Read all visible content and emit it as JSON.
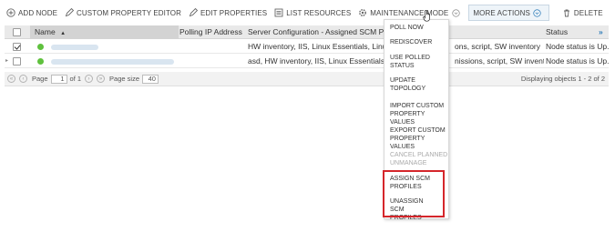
{
  "toolbar": {
    "add_node": "ADD NODE",
    "custom_property_editor": "CUSTOM PROPERTY EDITOR",
    "edit_properties": "EDIT PROPERTIES",
    "list_resources": "LIST RESOURCES",
    "maintenance_mode": "MAINTENANCE MODE",
    "more_actions": "MORE ACTIONS",
    "delete": "DELETE"
  },
  "table": {
    "headers": {
      "name": "Name",
      "polling_ip": "Polling IP Address",
      "server_config": "Server Configuration - Assigned SCM Pr",
      "status": "Status"
    },
    "rows": [
      {
        "checked": true,
        "server_config": "HW inventory, IIS, Linux Essentials, Linux Se",
        "server_config_tail": "ons, script, SW inventory",
        "status": "Node status is Up."
      },
      {
        "checked": false,
        "server_config": "asd, HW inventory, IIS, Linux Essentials, Lin",
        "server_config_tail": "nissions, script, SW inventory",
        "status": "Node status is Up."
      }
    ]
  },
  "pager": {
    "page_label": "Page",
    "page_value": "1",
    "of_label": "of 1",
    "page_size_label": "Page size",
    "page_size_value": "40",
    "displaying": "Displaying objects 1 - 2 of 2"
  },
  "menu": {
    "items": [
      "POLL NOW",
      "REDISCOVER",
      "USE POLLED STATUS",
      "UPDATE TOPOLOGY",
      "IMPORT CUSTOM PROPERTY VALUES",
      "EXPORT CUSTOM PROPERTY VALUES",
      "CANCEL PLANNED UNMANAGE",
      "ASSIGN SCM PROFILES",
      "UNASSIGN SCM PROFILES"
    ]
  },
  "colors": {
    "status_up": "#5fc13e",
    "highlight": "#d5262b",
    "accent_link": "#2a7ab8"
  }
}
